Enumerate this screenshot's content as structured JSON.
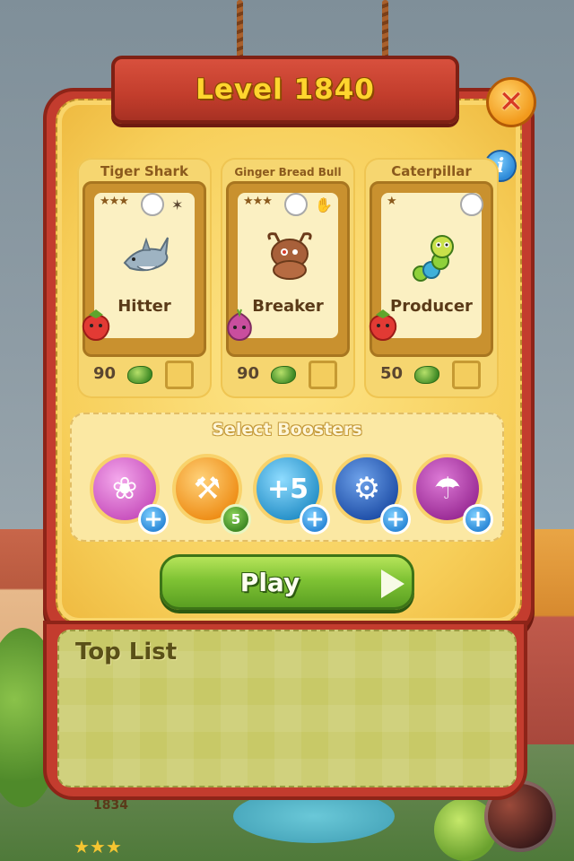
{
  "header": {
    "title": "Level 1840"
  },
  "characters": [
    {
      "name": "Tiger Shark",
      "stars": "★★★",
      "role": "Hitter",
      "cost": "90",
      "bonus_fruit": "strawberry",
      "creature": "shark"
    },
    {
      "name": "Ginger Bread Bull",
      "stars": "★★★",
      "role": "Breaker",
      "cost": "90",
      "bonus_fruit": "onion",
      "creature": "bull"
    },
    {
      "name": "Caterpillar",
      "stars": "★",
      "role": "Producer",
      "cost": "50",
      "bonus_fruit": "strawberry",
      "creature": "caterpillar"
    }
  ],
  "boosters": {
    "title": "Select Boosters",
    "items": [
      {
        "id": "lotus",
        "glyph": "❀",
        "color": "#e27ad9"
      },
      {
        "id": "shovel",
        "glyph": "⚒",
        "color": "#f3a52b",
        "count": "5"
      },
      {
        "id": "plus5",
        "glyph": "+5",
        "color": "#3fa7d9"
      },
      {
        "id": "gears",
        "glyph": "⚙",
        "color": "#2f6cc4"
      },
      {
        "id": "parachute",
        "glyph": "☂",
        "color": "#b23aa8"
      }
    ],
    "plus_glyph": "+"
  },
  "play": {
    "label": "Play"
  },
  "top_list": {
    "title": "Top List"
  },
  "background": {
    "level_node": "1834",
    "stars": "★★★"
  },
  "buttons": {
    "close_glyph": "✕",
    "info_glyph": "i"
  },
  "colors": {
    "frame_red": "#c33c2e",
    "panel_yellow": "#f7cf5a",
    "play_green": "#7fc334",
    "title_gold": "#ffd52e"
  }
}
